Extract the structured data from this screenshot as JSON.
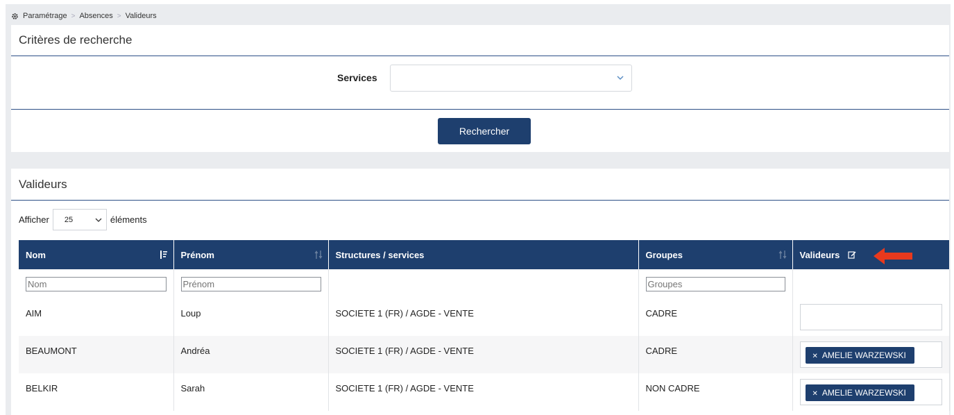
{
  "breadcrumb": [
    "Paramétrage",
    "Absences",
    "Valideurs"
  ],
  "search_panel": {
    "title": "Critères de recherche",
    "services_label": "Services",
    "services_value": "",
    "search_button": "Rechercher"
  },
  "results_panel": {
    "title": "Valideurs",
    "show_label": "Afficher",
    "page_length": "25",
    "elements_label": "éléments"
  },
  "table": {
    "headers": [
      "Nom",
      "Prénom",
      "Structures / services",
      "Groupes",
      "Valideurs"
    ],
    "filter_placeholders": {
      "nom": "Nom",
      "prenom": "Prénom",
      "groupes": "Groupes"
    },
    "rows": [
      {
        "nom": "AIM",
        "prenom": "Loup",
        "structure": "SOCIETE 1 (FR) / AGDE - VENTE",
        "groupe": "CADRE",
        "valideur": ""
      },
      {
        "nom": "BEAUMONT",
        "prenom": "Andréa",
        "structure": "SOCIETE 1 (FR) / AGDE - VENTE",
        "groupe": "CADRE",
        "valideur": "AMELIE WARZEWSKI"
      },
      {
        "nom": "BELKIR",
        "prenom": "Sarah",
        "structure": "SOCIETE 1 (FR) / AGDE - VENTE",
        "groupe": "NON CADRE",
        "valideur": "AMELIE WARZEWSKI"
      }
    ]
  },
  "colors": {
    "primary": "#1e3f6e",
    "arrow": "#e8391d"
  }
}
